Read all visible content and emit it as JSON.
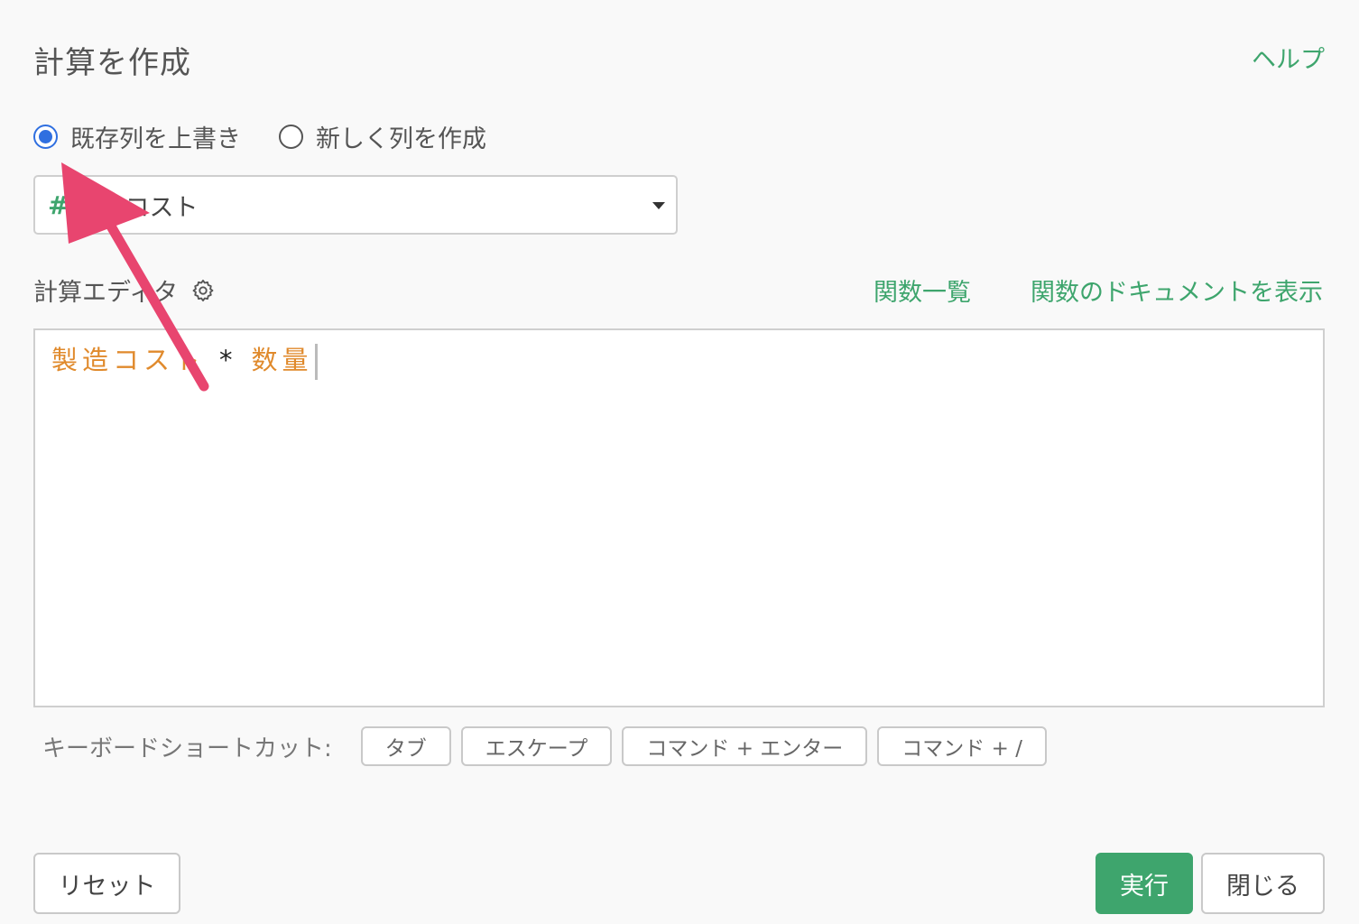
{
  "dialog": {
    "title": "計算を作成",
    "help_label": "ヘルプ"
  },
  "mode": {
    "options": [
      {
        "label": "既存列を上書き",
        "checked": true
      },
      {
        "label": "新しく列を作成",
        "checked": false
      }
    ]
  },
  "column_select": {
    "type_symbol": "#",
    "value": "製造コスト"
  },
  "editor": {
    "label": "計算エディタ",
    "function_list_label": "関数一覧",
    "function_docs_label": "関数のドキュメントを表示",
    "expression": {
      "left_column": "製造コスト",
      "operator": "*",
      "right_column": "数量"
    }
  },
  "shortcuts": {
    "label": "キーボードショートカット:",
    "keys": [
      "タブ",
      "エスケープ",
      "コマンド + エンター",
      "コマンド + /"
    ]
  },
  "footer": {
    "reset_label": "リセット",
    "run_label": "実行",
    "close_label": "閉じる"
  },
  "colors": {
    "accent_green": "#3ea56d",
    "radio_blue": "#2f6fe0",
    "column_token_orange": "#e08a2c",
    "annotation_pink": "#e8456f"
  }
}
